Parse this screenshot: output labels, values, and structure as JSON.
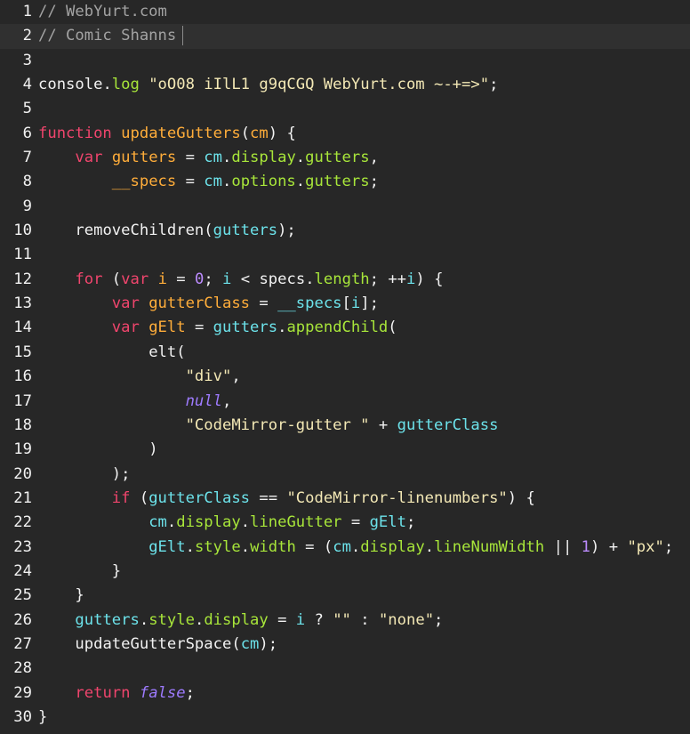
{
  "editor": {
    "active_line": 2,
    "colors": {
      "background": "#272727",
      "active_line_background": "#303030",
      "comment": "#a3a3a3",
      "keyword": "#f0456d",
      "function": "#ffad3a",
      "property": "#a8e63a",
      "variable": "#6ce2ea",
      "string": "#f3e8b5",
      "number": "#bd8cff",
      "plain": "#f2f2f2"
    },
    "lines": [
      {
        "n": "1",
        "tokens": [
          {
            "t": "// WebYurt.com",
            "c": "comment"
          }
        ]
      },
      {
        "n": "2",
        "cursor": true,
        "tokens": [
          {
            "t": "// Comic Shanns",
            "c": "comment"
          }
        ]
      },
      {
        "n": "3",
        "tokens": []
      },
      {
        "n": "4",
        "tokens": [
          {
            "t": "console",
            "c": "plain"
          },
          {
            "t": ".",
            "c": "plain"
          },
          {
            "t": "log",
            "c": "prop"
          },
          {
            "t": " ",
            "c": "plain"
          },
          {
            "t": "\"oO08 iIlL1 g9qCGQ WebYurt.com ~-+=>\"",
            "c": "str"
          },
          {
            "t": ";",
            "c": "plain"
          }
        ]
      },
      {
        "n": "5",
        "tokens": []
      },
      {
        "n": "6",
        "tokens": [
          {
            "t": "function",
            "c": "kw"
          },
          {
            "t": " ",
            "c": "plain"
          },
          {
            "t": "updateGutters",
            "c": "fn"
          },
          {
            "t": "(",
            "c": "plain"
          },
          {
            "t": "cm",
            "c": "fn"
          },
          {
            "t": ") {",
            "c": "plain"
          }
        ]
      },
      {
        "n": "7",
        "tokens": [
          {
            "t": "    ",
            "c": "plain"
          },
          {
            "t": "var",
            "c": "kw"
          },
          {
            "t": " ",
            "c": "plain"
          },
          {
            "t": "gutters",
            "c": "fn"
          },
          {
            "t": " = ",
            "c": "plain"
          },
          {
            "t": "cm",
            "c": "var"
          },
          {
            "t": ".",
            "c": "plain"
          },
          {
            "t": "display",
            "c": "prop"
          },
          {
            "t": ".",
            "c": "plain"
          },
          {
            "t": "gutters",
            "c": "prop"
          },
          {
            "t": ",",
            "c": "plain"
          }
        ]
      },
      {
        "n": "8",
        "tokens": [
          {
            "t": "        ",
            "c": "plain"
          },
          {
            "t": "__specs",
            "c": "fn"
          },
          {
            "t": " = ",
            "c": "plain"
          },
          {
            "t": "cm",
            "c": "var"
          },
          {
            "t": ".",
            "c": "plain"
          },
          {
            "t": "options",
            "c": "prop"
          },
          {
            "t": ".",
            "c": "plain"
          },
          {
            "t": "gutters",
            "c": "prop"
          },
          {
            "t": ";",
            "c": "plain"
          }
        ]
      },
      {
        "n": "9",
        "tokens": []
      },
      {
        "n": "10",
        "tokens": [
          {
            "t": "    ",
            "c": "plain"
          },
          {
            "t": "removeChildren",
            "c": "plain"
          },
          {
            "t": "(",
            "c": "plain"
          },
          {
            "t": "gutters",
            "c": "var"
          },
          {
            "t": ");",
            "c": "plain"
          }
        ]
      },
      {
        "n": "11",
        "tokens": []
      },
      {
        "n": "12",
        "tokens": [
          {
            "t": "    ",
            "c": "plain"
          },
          {
            "t": "for",
            "c": "kw"
          },
          {
            "t": " (",
            "c": "plain"
          },
          {
            "t": "var",
            "c": "kw"
          },
          {
            "t": " ",
            "c": "plain"
          },
          {
            "t": "i",
            "c": "fn"
          },
          {
            "t": " = ",
            "c": "plain"
          },
          {
            "t": "0",
            "c": "num"
          },
          {
            "t": "; ",
            "c": "plain"
          },
          {
            "t": "i",
            "c": "var"
          },
          {
            "t": " < ",
            "c": "plain"
          },
          {
            "t": "specs",
            "c": "plain"
          },
          {
            "t": ".",
            "c": "plain"
          },
          {
            "t": "length",
            "c": "prop"
          },
          {
            "t": "; ++",
            "c": "plain"
          },
          {
            "t": "i",
            "c": "var"
          },
          {
            "t": ") {",
            "c": "plain"
          }
        ]
      },
      {
        "n": "13",
        "tokens": [
          {
            "t": "        ",
            "c": "plain"
          },
          {
            "t": "var",
            "c": "kw"
          },
          {
            "t": " ",
            "c": "plain"
          },
          {
            "t": "gutterClass",
            "c": "fn"
          },
          {
            "t": " = ",
            "c": "plain"
          },
          {
            "t": "__specs",
            "c": "var"
          },
          {
            "t": "[",
            "c": "plain"
          },
          {
            "t": "i",
            "c": "var"
          },
          {
            "t": "];",
            "c": "plain"
          }
        ]
      },
      {
        "n": "14",
        "tokens": [
          {
            "t": "        ",
            "c": "plain"
          },
          {
            "t": "var",
            "c": "kw"
          },
          {
            "t": " ",
            "c": "plain"
          },
          {
            "t": "gElt",
            "c": "fn"
          },
          {
            "t": " = ",
            "c": "plain"
          },
          {
            "t": "gutters",
            "c": "var"
          },
          {
            "t": ".",
            "c": "plain"
          },
          {
            "t": "appendChild",
            "c": "prop"
          },
          {
            "t": "(",
            "c": "plain"
          }
        ]
      },
      {
        "n": "15",
        "tokens": [
          {
            "t": "            ",
            "c": "plain"
          },
          {
            "t": "elt",
            "c": "plain"
          },
          {
            "t": "(",
            "c": "plain"
          }
        ]
      },
      {
        "n": "16",
        "tokens": [
          {
            "t": "                ",
            "c": "plain"
          },
          {
            "t": "\"div\"",
            "c": "str"
          },
          {
            "t": ",",
            "c": "plain"
          }
        ]
      },
      {
        "n": "17",
        "tokens": [
          {
            "t": "                ",
            "c": "plain"
          },
          {
            "t": "null",
            "c": "null"
          },
          {
            "t": ",",
            "c": "plain"
          }
        ]
      },
      {
        "n": "18",
        "tokens": [
          {
            "t": "                ",
            "c": "plain"
          },
          {
            "t": "\"CodeMirror-gutter \"",
            "c": "str"
          },
          {
            "t": " + ",
            "c": "plain"
          },
          {
            "t": "gutterClass",
            "c": "var"
          }
        ]
      },
      {
        "n": "19",
        "tokens": [
          {
            "t": "            ",
            "c": "plain"
          },
          {
            "t": ")",
            "c": "plain"
          }
        ]
      },
      {
        "n": "20",
        "tokens": [
          {
            "t": "        ",
            "c": "plain"
          },
          {
            "t": ");",
            "c": "plain"
          }
        ]
      },
      {
        "n": "21",
        "tokens": [
          {
            "t": "        ",
            "c": "plain"
          },
          {
            "t": "if",
            "c": "kw"
          },
          {
            "t": " (",
            "c": "plain"
          },
          {
            "t": "gutterClass",
            "c": "var"
          },
          {
            "t": " == ",
            "c": "plain"
          },
          {
            "t": "\"CodeMirror-linenumbers\"",
            "c": "str"
          },
          {
            "t": ") {",
            "c": "plain"
          }
        ]
      },
      {
        "n": "22",
        "tokens": [
          {
            "t": "            ",
            "c": "plain"
          },
          {
            "t": "cm",
            "c": "var"
          },
          {
            "t": ".",
            "c": "plain"
          },
          {
            "t": "display",
            "c": "prop"
          },
          {
            "t": ".",
            "c": "plain"
          },
          {
            "t": "lineGutter",
            "c": "prop"
          },
          {
            "t": " = ",
            "c": "plain"
          },
          {
            "t": "gElt",
            "c": "var"
          },
          {
            "t": ";",
            "c": "plain"
          }
        ]
      },
      {
        "n": "23",
        "tokens": [
          {
            "t": "            ",
            "c": "plain"
          },
          {
            "t": "gElt",
            "c": "var"
          },
          {
            "t": ".",
            "c": "plain"
          },
          {
            "t": "style",
            "c": "prop"
          },
          {
            "t": ".",
            "c": "plain"
          },
          {
            "t": "width",
            "c": "prop"
          },
          {
            "t": " = (",
            "c": "plain"
          },
          {
            "t": "cm",
            "c": "var"
          },
          {
            "t": ".",
            "c": "plain"
          },
          {
            "t": "display",
            "c": "prop"
          },
          {
            "t": ".",
            "c": "plain"
          },
          {
            "t": "lineNumWidth",
            "c": "prop"
          },
          {
            "t": " || ",
            "c": "plain"
          },
          {
            "t": "1",
            "c": "num"
          },
          {
            "t": ") + ",
            "c": "plain"
          },
          {
            "t": "\"px\"",
            "c": "str"
          },
          {
            "t": ";",
            "c": "plain"
          }
        ]
      },
      {
        "n": "24",
        "tokens": [
          {
            "t": "        ",
            "c": "plain"
          },
          {
            "t": "}",
            "c": "plain"
          }
        ]
      },
      {
        "n": "25",
        "tokens": [
          {
            "t": "    ",
            "c": "plain"
          },
          {
            "t": "}",
            "c": "plain"
          }
        ]
      },
      {
        "n": "26",
        "tokens": [
          {
            "t": "    ",
            "c": "plain"
          },
          {
            "t": "gutters",
            "c": "var"
          },
          {
            "t": ".",
            "c": "plain"
          },
          {
            "t": "style",
            "c": "prop"
          },
          {
            "t": ".",
            "c": "plain"
          },
          {
            "t": "display",
            "c": "prop"
          },
          {
            "t": " = ",
            "c": "plain"
          },
          {
            "t": "i",
            "c": "var"
          },
          {
            "t": " ? ",
            "c": "plain"
          },
          {
            "t": "\"\"",
            "c": "str"
          },
          {
            "t": " : ",
            "c": "plain"
          },
          {
            "t": "\"none\"",
            "c": "str"
          },
          {
            "t": ";",
            "c": "plain"
          }
        ]
      },
      {
        "n": "27",
        "tokens": [
          {
            "t": "    ",
            "c": "plain"
          },
          {
            "t": "updateGutterSpace",
            "c": "plain"
          },
          {
            "t": "(",
            "c": "plain"
          },
          {
            "t": "cm",
            "c": "var"
          },
          {
            "t": ");",
            "c": "plain"
          }
        ]
      },
      {
        "n": "28",
        "tokens": []
      },
      {
        "n": "29",
        "tokens": [
          {
            "t": "    ",
            "c": "plain"
          },
          {
            "t": "return",
            "c": "kw"
          },
          {
            "t": " ",
            "c": "plain"
          },
          {
            "t": "false",
            "c": "null"
          },
          {
            "t": ";",
            "c": "plain"
          }
        ]
      },
      {
        "n": "30",
        "tokens": [
          {
            "t": "}",
            "c": "plain"
          }
        ]
      }
    ]
  }
}
